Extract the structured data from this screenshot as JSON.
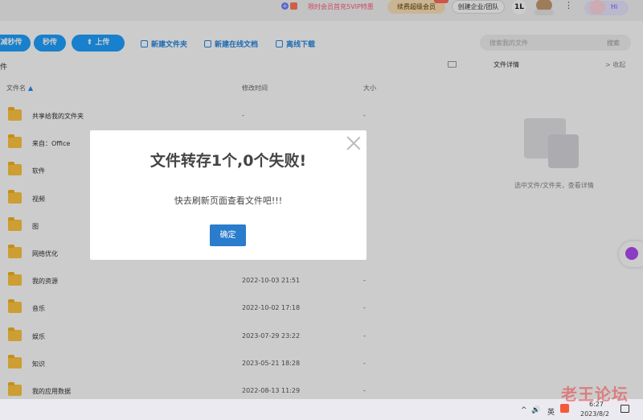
{
  "header": {
    "promo_text": "限时会员首充5VIP特惠",
    "renew_label": "续费超级会员",
    "create_org_label": "创建企业/团队",
    "cloud_label": "1L",
    "more_label": "⋮",
    "assistant_label": "Hi"
  },
  "toolbar": {
    "btn_instant_partial": "减秒传",
    "btn_instant": "秒传",
    "btn_upload": "上传",
    "new_folder": "新建文件夹",
    "new_doc": "新建在线文档",
    "offline_download": "离线下载",
    "search_placeholder": "搜索我的文件",
    "search_button": "搜索"
  },
  "list": {
    "breadcrumb": "件",
    "columns": {
      "name": "文件名",
      "sort_icon": "▲",
      "time": "修改时间",
      "size": "大小"
    },
    "rows": [
      {
        "name": "共享给我的文件夹",
        "time": "-",
        "size": "-"
      },
      {
        "name": "来自：Office",
        "time": "",
        "size": ""
      },
      {
        "name": "软件",
        "time": "",
        "size": ""
      },
      {
        "name": "视频",
        "time": "",
        "size": ""
      },
      {
        "name": "图",
        "time": "",
        "size": ""
      },
      {
        "name": "网络优化",
        "time": "",
        "size": ""
      },
      {
        "name": "我的资源",
        "time": "2022-10-03 21:51",
        "size": "-"
      },
      {
        "name": "音乐",
        "time": "2022-10-02 17:18",
        "size": "-"
      },
      {
        "name": "娱乐",
        "time": "2023-07-29 23:22",
        "size": "-"
      },
      {
        "name": "知识",
        "time": "2023-05-21 18:28",
        "size": "-"
      },
      {
        "name": "我的应用数据",
        "time": "2022-08-13 11:29",
        "size": "-"
      }
    ]
  },
  "detail": {
    "title": "文件详情",
    "collapse": "> 收起",
    "hint": "选中文件/文件夹，查看详情"
  },
  "modal": {
    "title": "文件转存1个,0个失败!",
    "message": "快去刷新页面查看文件吧!!!",
    "ok_label": "确定"
  },
  "taskbar": {
    "tray_up": "^",
    "volume": "🔊",
    "ime": "英",
    "time": "6:27",
    "date": "2023/8/2",
    "watermark": "老王论坛"
  }
}
